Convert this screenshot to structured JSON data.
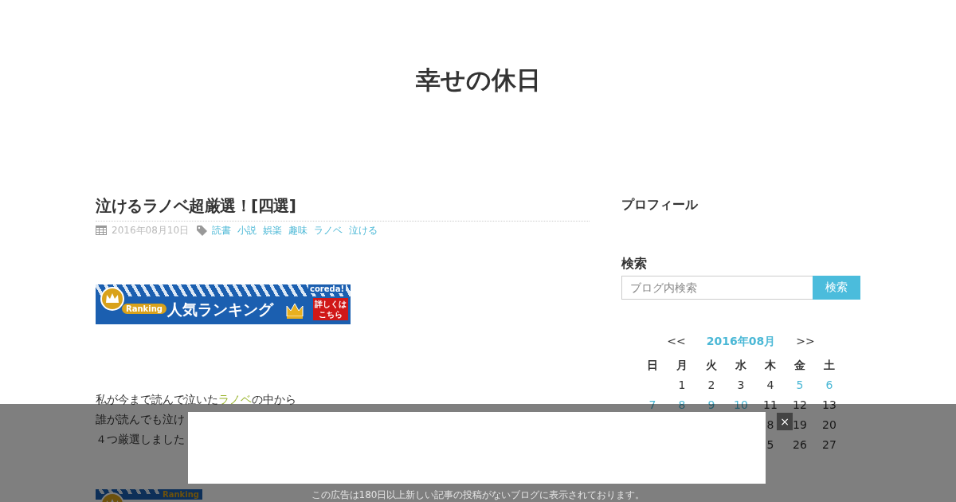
{
  "site_title": "幸せの休日",
  "post": {
    "title": "泣けるラノベ超厳選！[四選]",
    "date": "2016年08月10日",
    "tags": [
      "読書",
      "小説",
      "娯楽",
      "趣味",
      "ラノベ",
      "泣ける"
    ],
    "banner": {
      "brand": "coreda!",
      "badge": "Ranking",
      "headline": "人気ランキング",
      "button": "詳しくはこちら"
    },
    "lines": [
      "私が今まで読んで泣いた",
      "ラノベ",
      "の中から"
    ],
    "lines_more": [
      "誰が読んでも泣け",
      "４つ厳選しました"
    ],
    "banner2": {
      "badge": "Ranking"
    }
  },
  "sidebar": {
    "profile_heading": "プロフィール",
    "search_heading": "検索",
    "search": {
      "placeholder": "ブログ内検索",
      "button": "検索"
    },
    "calendar": {
      "prev": "<<",
      "month": "2016年08月",
      "next": ">>",
      "weekdays": [
        "日",
        "月",
        "火",
        "水",
        "木",
        "金",
        "土"
      ],
      "weeks": [
        [
          {
            "day": "1",
            "linked": false
          },
          {
            "day": "2",
            "linked": false
          },
          {
            "day": "3",
            "linked": false
          },
          {
            "day": "4",
            "linked": false
          },
          {
            "day": "5",
            "linked": true
          },
          {
            "day": "6",
            "linked": true
          }
        ],
        [
          {
            "day": "7",
            "linked": true
          },
          {
            "day": "8",
            "linked": true
          },
          {
            "day": "9",
            "linked": true
          },
          {
            "day": "10",
            "linked": true
          },
          {
            "day": "11",
            "linked": false
          },
          {
            "day": "12",
            "linked": false
          },
          {
            "day": "13",
            "linked": false
          }
        ],
        [
          {
            "day": "8",
            "linked": false
          },
          {
            "day": "19",
            "linked": false
          },
          {
            "day": "20",
            "linked": false
          }
        ],
        [
          {
            "day": "5",
            "linked": false
          },
          {
            "day": "26",
            "linked": false
          },
          {
            "day": "27",
            "linked": false
          }
        ]
      ]
    }
  },
  "ad_overlay": {
    "close": "×",
    "notice": "この広告は180日以上新しい記事の投稿がないブログに表示されております。"
  }
}
